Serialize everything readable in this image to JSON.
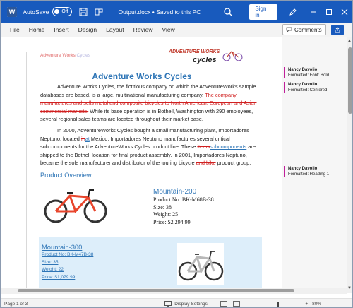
{
  "titlebar": {
    "autosave_label": "AutoSave",
    "autosave_state": "Off",
    "doc_title": "Output.docx  •  Saved to this PC",
    "signin_label": "Sign in",
    "bg_color": "#185abd"
  },
  "menu": {
    "items": [
      "File",
      "Home",
      "Insert",
      "Design",
      "Layout",
      "Review",
      "View"
    ],
    "comments_label": "Comments"
  },
  "document": {
    "header_left_a": "Adventure Works",
    "header_left_b": "Cycles",
    "logo_text_top": "ADVENTURE WORKS",
    "logo_text_bottom": "cycles",
    "title": "Adventure Works Cycles",
    "p1_a": "Adventure Works Cycles, the fictitious company on which the AdventureWorks sample databases are based, is a large, multinational manufacturing company. ",
    "p1_del": "The company manufactures and sells metal and composite bicycles to North American, European and Asian commercial markets.",
    "p1_b": " While its base operation is in Bothell, Washington with 290 employees, several regional sales teams are located throughout their market base.",
    "p2_a": "In 2000, AdventureWorks Cycles bought a small manufacturing plant, Importadores Neptuno, located ",
    "p2_del1": "in",
    "p2_ins1": "at",
    "p2_b": " Mexico. Importadores Neptuno manufactures several critical subcomponents for the AdventureWorks Cycles product line. These ",
    "p2_del2": "items",
    "p2_ins2": "subcomponents",
    "p2_c": " are shipped to the Bothell location for final product assembly. In 2001, Importadores Neptuno, became the sole manufacturer and distributor of the touring bicycle ",
    "p2_del3": "and bike",
    "p2_d": " product group.",
    "section_heading": "Product Overview",
    "product1": {
      "name": "Mountain-200",
      "number": "Product No: BK-M68B-38",
      "size": "Size: 38",
      "weight": "Weight: 25",
      "price": "Price: $2,294.99"
    },
    "product2": {
      "name": "Mountain-300",
      "number": "Product No: BK-M47B-38",
      "size": "Size: 35",
      "weight": "Weight: 22",
      "price": "Price: $1,079.99"
    }
  },
  "markup": {
    "balloons": [
      {
        "author": "Nancy Davolio",
        "text": "Formatted: Font: Bold"
      },
      {
        "author": "Nancy Davolio",
        "text": "Formatted: Centered"
      },
      {
        "author": "Nancy Davolio",
        "text": "Formatted: Heading 1"
      }
    ],
    "color": "#c0209a"
  },
  "statusbar": {
    "page": "Page 1 of 3",
    "display_settings": "Display Settings",
    "zoom_minus": "—",
    "zoom_plus": "+",
    "zoom": "80%",
    "zoom_level_percent": 80
  }
}
